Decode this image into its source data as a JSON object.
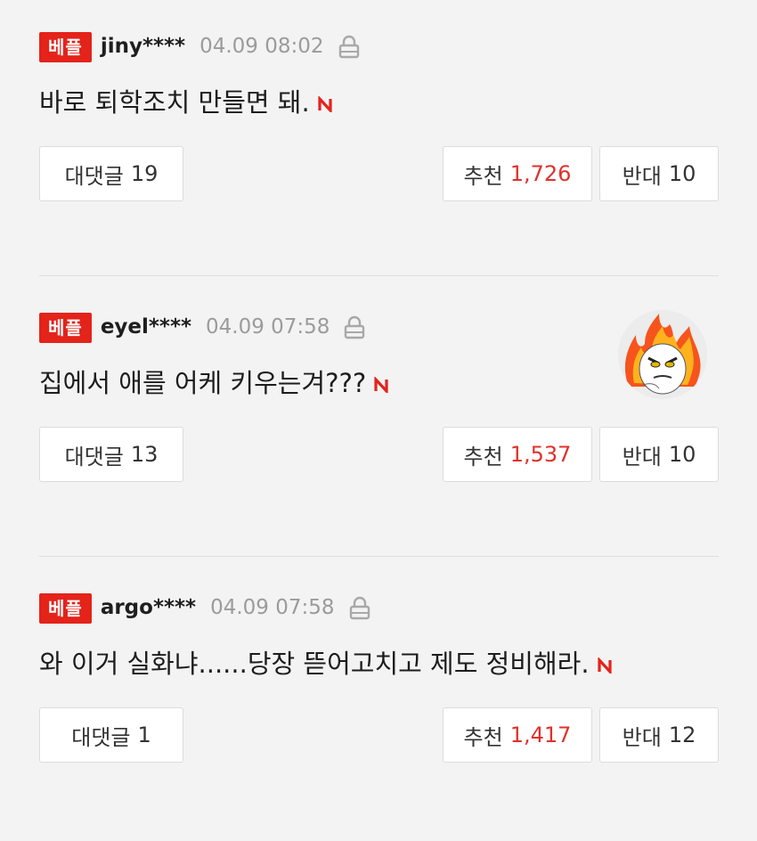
{
  "comments": [
    {
      "badge": "베플",
      "username": "jiny****",
      "time": "04.09 08:02",
      "text": "바로 퇴학조치 만들면 돼.",
      "reply_label": "대댓글",
      "reply_count": "19",
      "like_label": "추천",
      "like_count": "1,726",
      "dislike_label": "반대",
      "dislike_count": "10"
    },
    {
      "badge": "베플",
      "username": "eyel****",
      "time": "04.09 07:58",
      "text": "집에서 애를 어케 키우는겨???",
      "reply_label": "대댓글",
      "reply_count": "13",
      "like_label": "추천",
      "like_count": "1,537",
      "dislike_label": "반대",
      "dislike_count": "10",
      "avatar": "flaming-angry-face-avatar"
    },
    {
      "badge": "베플",
      "username": "argo****",
      "time": "04.09 07:58",
      "text": "와 이거 실화냐......당장 뜯어고치고 제도 정비해라.",
      "reply_label": "대댓글",
      "reply_count": "1",
      "like_label": "추천",
      "like_count": "1,417",
      "dislike_label": "반대",
      "dislike_count": "12"
    }
  ],
  "colors": {
    "badge_bg": "#e4231b",
    "like_count": "#e0312b",
    "timestamp": "#9b9b9b",
    "background": "#f3f3f3"
  },
  "icons": {
    "lock": "lock-icon",
    "new": "new-n-icon"
  }
}
